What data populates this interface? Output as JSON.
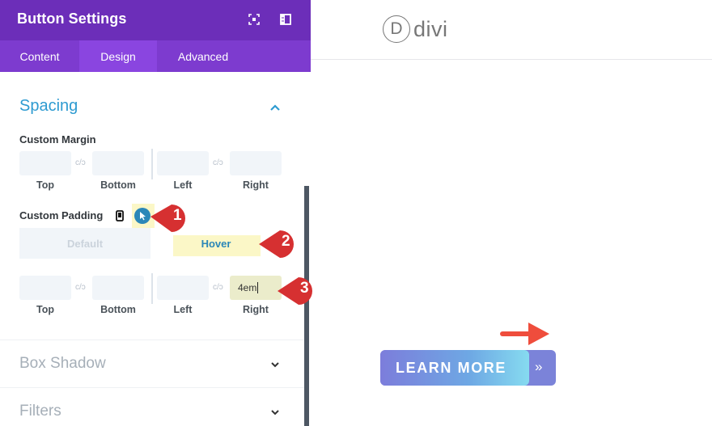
{
  "panel": {
    "title": "Button Settings",
    "header_icons": [
      "fullscreen-icon",
      "sidebar-layout-icon"
    ],
    "tabs": [
      {
        "label": "Content",
        "active": false
      },
      {
        "label": "Design",
        "active": true
      },
      {
        "label": "Advanced",
        "active": false
      }
    ],
    "spacing": {
      "title": "Spacing",
      "expanded": true,
      "margin": {
        "label": "Custom Margin",
        "fields": [
          {
            "label": "Top",
            "value": ""
          },
          {
            "label": "Bottom",
            "value": ""
          },
          {
            "label": "Left",
            "value": ""
          },
          {
            "label": "Right",
            "value": ""
          }
        ]
      },
      "padding": {
        "label": "Custom Padding",
        "toggle": {
          "default": "Default",
          "hover": "Hover",
          "active": "Hover"
        },
        "fields": [
          {
            "label": "Top",
            "value": ""
          },
          {
            "label": "Bottom",
            "value": ""
          },
          {
            "label": "Left",
            "value": ""
          },
          {
            "label": "Right",
            "value": "4em"
          }
        ]
      },
      "link_icon": "link-icon"
    },
    "collapsed_sections": [
      "Box Shadow",
      "Filters"
    ]
  },
  "callouts": [
    "1",
    "2",
    "3"
  ],
  "preview": {
    "logo_letter": "D",
    "logo_text": "divi",
    "button_label": "LEARN MORE",
    "button_icon": "»"
  },
  "colors": {
    "header": "#6c2eb9",
    "tabs": "#7d3bcf",
    "active_tab": "#8a45e0",
    "accent": "#2e9bd1",
    "callout": "#d63031",
    "arrow": "#ef4d3c"
  }
}
